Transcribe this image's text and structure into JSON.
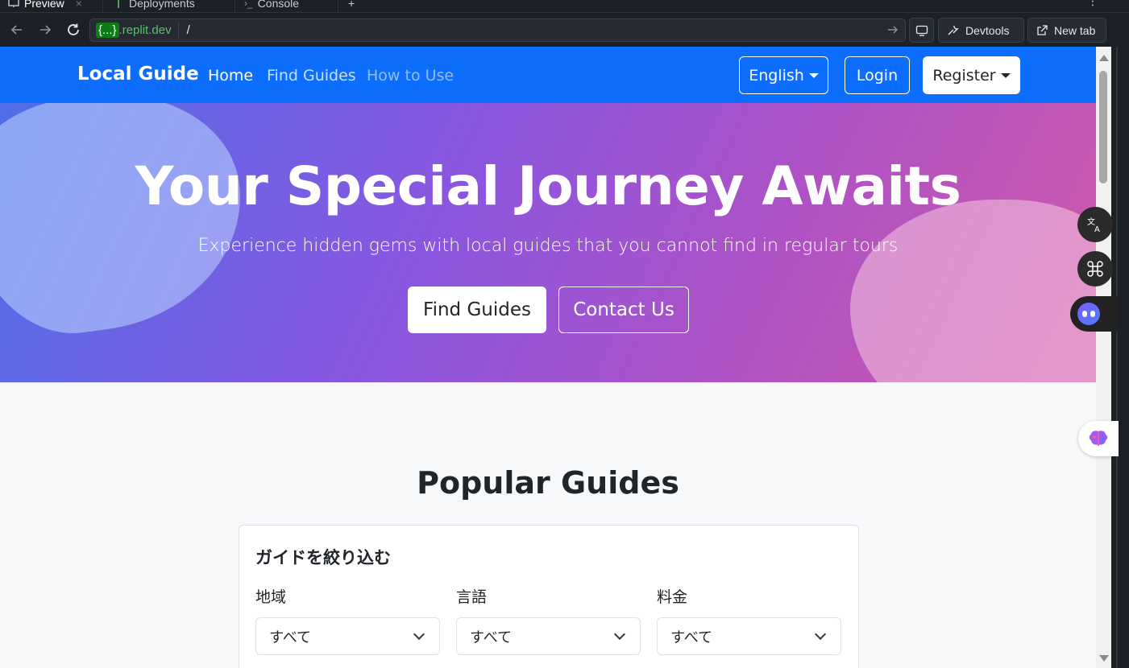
{
  "ide": {
    "tabs": [
      {
        "label": "Preview"
      },
      {
        "label": "Deployments"
      },
      {
        "label": "Console"
      }
    ],
    "new_tab_symbol": "+",
    "menu_symbol": "⋮"
  },
  "browser": {
    "url_braces": "{...}",
    "url_domain": ".replit.dev",
    "url_path": "/",
    "devtools_label": "Devtools",
    "new_tab_label": "New tab"
  },
  "navbar": {
    "brand": "Local Guide",
    "links": [
      {
        "label": "Home",
        "active": true
      },
      {
        "label": "Find Guides",
        "active": false
      },
      {
        "label": "How to Use",
        "active": false
      }
    ],
    "language_label": "English",
    "login_label": "Login",
    "register_label": "Register",
    "color": "#0d6efd"
  },
  "hero": {
    "title": "Your Special Journey Awaits",
    "subtitle": "Experience hidden gems with local guides that you cannot find in regular tours",
    "primary_button": "Find Guides",
    "secondary_button": "Contact Us"
  },
  "popular": {
    "title": "Popular Guides",
    "filter": {
      "title": "ガイドを絞り込む",
      "fields": [
        {
          "label": "地域",
          "value": "すべて"
        },
        {
          "label": "言語",
          "value": "すべて"
        },
        {
          "label": "料金",
          "value": "すべて"
        }
      ]
    }
  },
  "widgets": {
    "translate_icon": "translate-icon",
    "command_icon": "command-icon",
    "assistant_icon": "assistant-face-icon",
    "brain_icon": "brain-icon"
  }
}
